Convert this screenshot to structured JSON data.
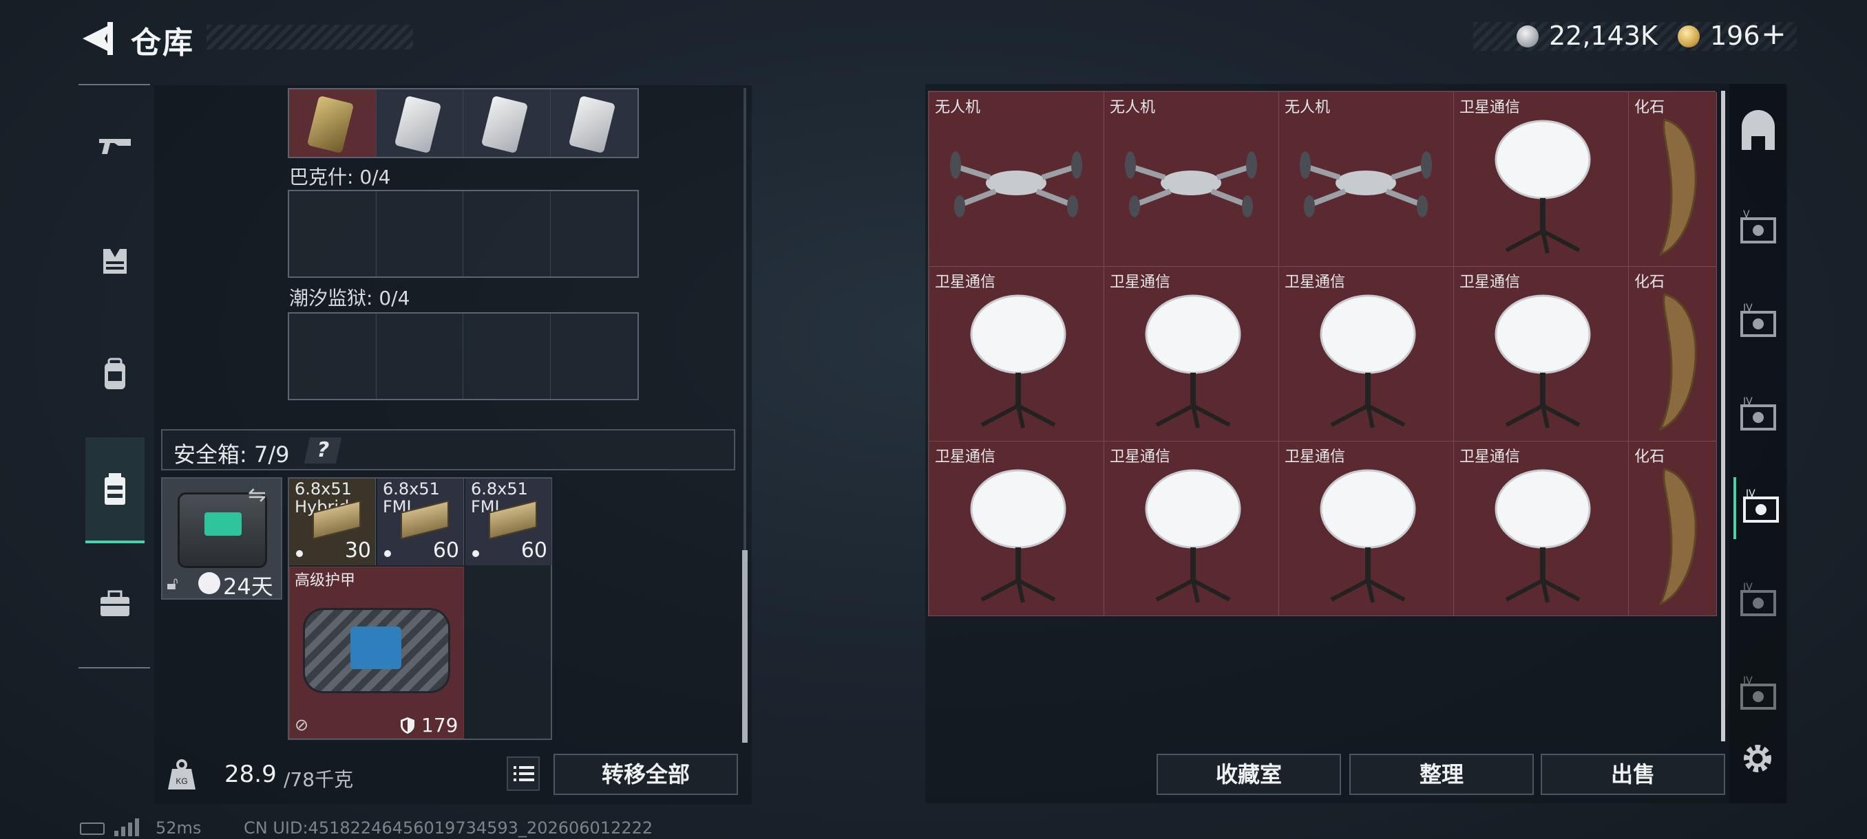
{
  "header": {
    "title": "仓库",
    "money": "22,143K",
    "credit": "196",
    "plus": "+"
  },
  "left_nav": {
    "items": [
      "gun-icon",
      "vest-icon",
      "backpack-icon",
      "bag-icon",
      "case-icon"
    ],
    "selected": "bag-icon"
  },
  "containers": {
    "bakesh_label": "巴克什: 0/4",
    "chaoxi_label": "潮汐监狱: 0/4"
  },
  "safe": {
    "label": "安全箱: 7/9",
    "help": "?",
    "timer": "24天",
    "ammo": [
      {
        "name": "6.8x51\nHybrid",
        "count": "30"
      },
      {
        "name": "6.8x51\nFMJ",
        "count": "60"
      },
      {
        "name": "6.8x51\nFMJ",
        "count": "60"
      }
    ],
    "armor": {
      "name": "高级护甲",
      "durability": "179"
    }
  },
  "weight": {
    "current": "28.9",
    "max": "/78千克"
  },
  "buttons": {
    "transfer_all": "转移全部",
    "collection": "收藏室",
    "sort": "整理",
    "sell": "出售"
  },
  "stash": {
    "rows": [
      [
        "无人机",
        "无人机",
        "无人机",
        "卫星通信",
        "化石"
      ],
      [
        "卫星通信",
        "卫星通信",
        "卫星通信",
        "卫星通信",
        "化石"
      ],
      [
        "卫星通信",
        "卫星通信",
        "卫星通信",
        "卫星通信",
        "化石"
      ]
    ]
  },
  "status": {
    "ping": "52ms",
    "uid": "CN UID:45182246456019734593_202606012222"
  },
  "colors": {
    "accent": "#4fd1a8",
    "item_bg": "#5a2a30"
  }
}
